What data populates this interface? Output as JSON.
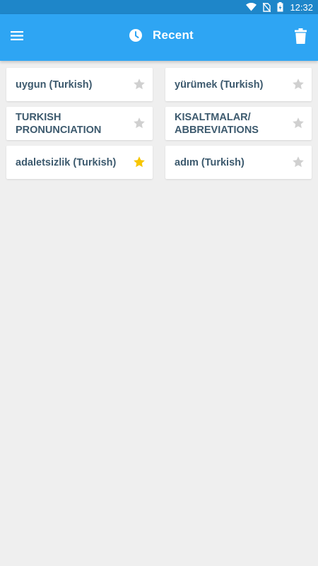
{
  "status_bar": {
    "time": "12:32"
  },
  "app_bar": {
    "title": "Recent",
    "menu_icon": "menu-icon",
    "title_icon": "clock-icon",
    "action_icon": "trash-icon"
  },
  "colors": {
    "app_bar": "#2ea5f3",
    "status_bar": "#1e86c9",
    "card_text": "#3d5a6e",
    "star_active": "#f7c600",
    "star_inactive": "#d0d0d0"
  },
  "items": [
    {
      "label": "uygun (Turkish)",
      "favorite": false
    },
    {
      "label": "yürümek (Turkish)",
      "favorite": false
    },
    {
      "label": "TURKISH PRONUNCIATION",
      "favorite": false
    },
    {
      "label": "KISALTMALAR/ ABBREVIATIONS",
      "favorite": false
    },
    {
      "label": "adaletsizlik (Turkish)",
      "favorite": true
    },
    {
      "label": "adım (Turkish)",
      "favorite": false
    }
  ]
}
